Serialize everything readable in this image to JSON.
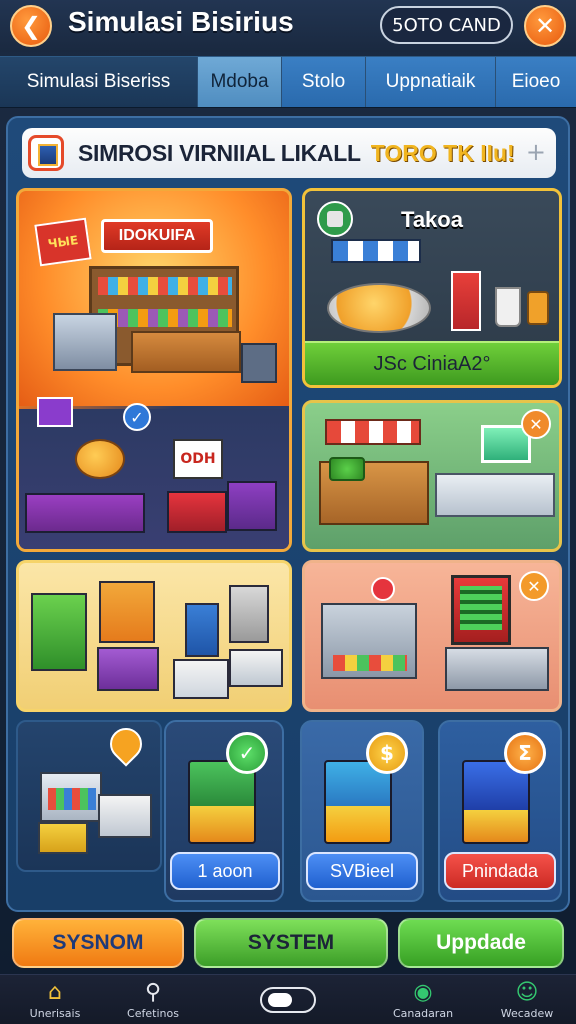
{
  "header": {
    "title": "Simulasi Bisirius",
    "coin_label": "5OTO CAND",
    "back_glyph": "❮",
    "close_glyph": "✕"
  },
  "tabs": [
    {
      "label": "Simulasi Biseriss"
    },
    {
      "label": "Mdoba"
    },
    {
      "label": "Stolo"
    },
    {
      "label": "Uppnatiaik"
    },
    {
      "label": "Eioeo"
    }
  ],
  "panel": {
    "title": "SIMROSI VIRNIIAL LIKALL",
    "accent": "TORO TK IIu!",
    "plus_glyph": "+"
  },
  "cards": {
    "store": {
      "sign": "IDOKUIFA",
      "tag": "ЧЫЕ",
      "odm": "ODH"
    },
    "takoa": {
      "title": "Takoa",
      "banner": "JSc CiniaA2°"
    },
    "market": {
      "badge_glyph": "✕"
    },
    "checkout": {
      "badge_glyph": "✕"
    }
  },
  "mini_cards": [
    {
      "button": "1 aoon",
      "badge_glyph": "✓"
    },
    {
      "button": "SVBieel",
      "badge_glyph": "$"
    },
    {
      "button": "Pnindada",
      "badge_glyph": "Σ"
    }
  ],
  "actions": [
    {
      "label": "SYSNOM"
    },
    {
      "label": "SYSTEM"
    },
    {
      "label": "Uppdade"
    }
  ],
  "bottom_nav": [
    {
      "label": "Unerisais",
      "icon": "home-icon",
      "glyph": "⌂"
    },
    {
      "label": "Cefetinos",
      "icon": "search-icon",
      "glyph": "⚲"
    },
    {
      "label": "",
      "icon": "toggle-icon",
      "glyph": ""
    },
    {
      "label": "Canadaran",
      "icon": "map-pin-icon",
      "glyph": "◉"
    },
    {
      "label": "Wecadew",
      "icon": "profile-icon",
      "glyph": "☺"
    }
  ],
  "colors": {
    "accent_orange": "#f07a12",
    "accent_green": "#3c9e28",
    "panel_blue": "#1f4a7a",
    "gold": "#f1b520"
  }
}
